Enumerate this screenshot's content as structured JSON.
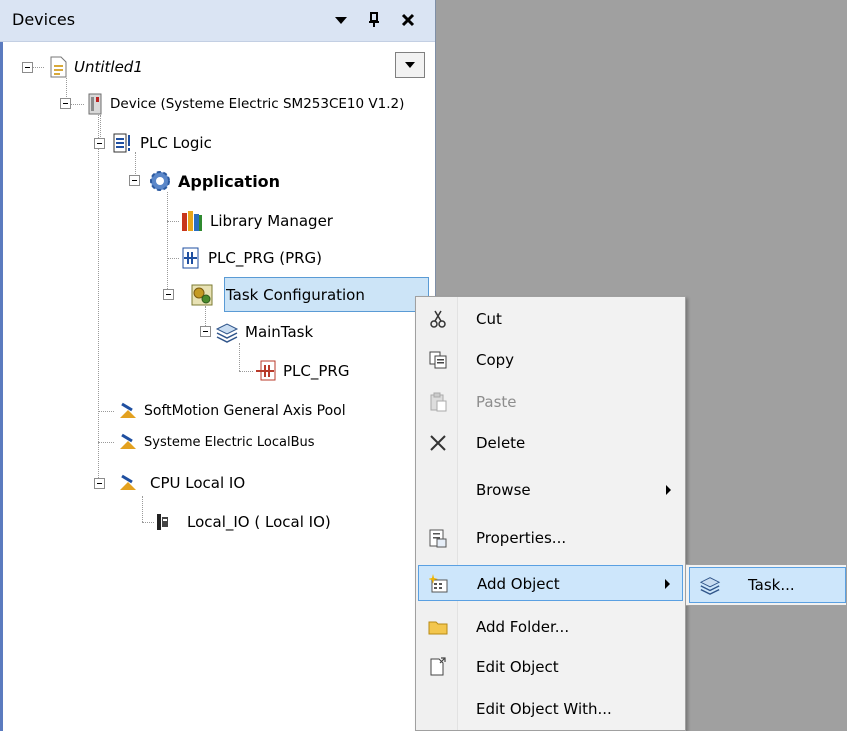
{
  "panel": {
    "title": "Devices",
    "controls": [
      "dropdown-arrow-icon",
      "pin-icon",
      "close-icon"
    ]
  },
  "tree": {
    "project": "Untitled1",
    "device": "Device (Systeme Electric SM253CE10 V1.2)",
    "plc_logic": "PLC Logic",
    "application": "Application",
    "library_manager": "Library Manager",
    "plc_prg": "PLC_PRG (PRG)",
    "task_configuration": "Task Configuration",
    "main_task": "MainTask",
    "main_task_prg": "PLC_PRG",
    "softmotion": "SoftMotion General Axis Pool",
    "localbus": "Systeme Electric LocalBus",
    "cpu_local_io": "CPU Local IO",
    "local_io": "Local_IO ( Local IO)"
  },
  "context_menu": {
    "items": [
      {
        "label": "Cut",
        "icon": "scissors-icon"
      },
      {
        "label": "Copy",
        "icon": "copy-icon"
      },
      {
        "label": "Paste",
        "icon": "paste-icon",
        "disabled": true
      },
      {
        "label": "Delete",
        "icon": "delete-icon"
      },
      {
        "label": "Browse",
        "icon": "",
        "submenu": true
      },
      {
        "label": "Properties...",
        "icon": "properties-icon"
      },
      {
        "label": "Add Object",
        "icon": "add-object-icon",
        "submenu": true,
        "highlighted": true
      },
      {
        "label": "Add Folder...",
        "icon": "folder-icon"
      },
      {
        "label": "Edit Object",
        "icon": "edit-object-icon"
      },
      {
        "label": "Edit Object With...",
        "icon": ""
      }
    ]
  },
  "submenu": {
    "items": [
      {
        "label": "Task...",
        "icon": "task-icon"
      }
    ]
  },
  "colors": {
    "titlebar_bg": "#dae4f3",
    "selection_bg": "#cce4f7",
    "highlight_border": "#5aa0e2",
    "workspace_bg": "#a0a0a0"
  }
}
